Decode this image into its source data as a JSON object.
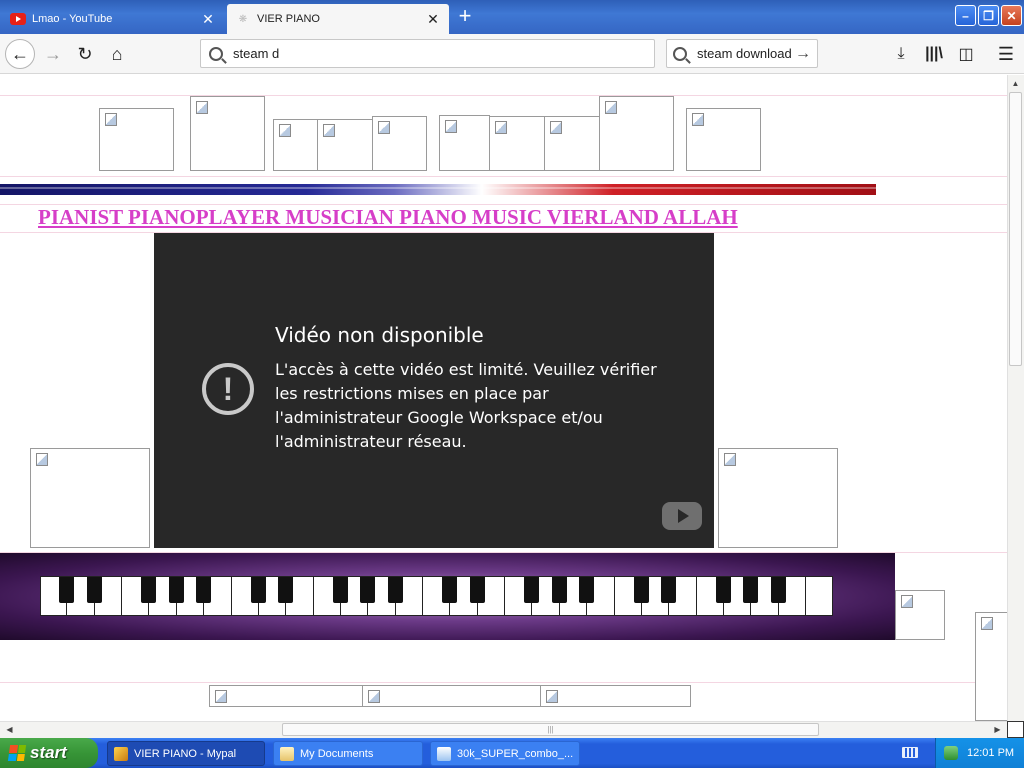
{
  "browser": {
    "tabs": [
      {
        "title": "Lmao - YouTube",
        "active": false,
        "favicon": "youtube-icon"
      },
      {
        "title": "VIER PIANO",
        "active": true,
        "favicon": "page-icon"
      }
    ],
    "new_tab_label": "+",
    "close_glyph": "✕",
    "window_controls": {
      "minimize": "–",
      "maximize": "❐",
      "close": "✕"
    },
    "nav": {
      "back": "←",
      "forward": "→",
      "reload": "↻",
      "home": "⌂"
    },
    "url_value": "steam d",
    "search_value": "steam download",
    "search_go": "→",
    "toolbar_icons": {
      "download": "⤓",
      "library": "|||\\",
      "sidebar": "◫",
      "menu": "☰"
    }
  },
  "page": {
    "heading": "PIANIST PIANOPLAYER MUSICIAN PIANO MUSIC VIERLAND ALLAH",
    "video": {
      "title": "Vidéo non disponible",
      "message": "L'accès à cette vidéo est limité. Veuillez vérifier les restrictions mises en place par l'administrateur Google Workspace et/ou l'administrateur réseau.",
      "error_glyph": "!"
    },
    "piano_white_keys": 29,
    "piano_black_key_pattern": [
      1,
      1,
      0,
      1,
      1,
      1,
      0
    ]
  },
  "scrollbars": {
    "up": "▲",
    "left": "◀",
    "right": "▶",
    "grip": "|||"
  },
  "taskbar": {
    "start_label": "start",
    "items": [
      {
        "label": "VIER PIANO - Mypal",
        "active": true
      },
      {
        "label": "My Documents",
        "active": false
      },
      {
        "label": "30k_SUPER_combo_...",
        "active": false
      }
    ],
    "clock": "12:01 PM"
  },
  "colors": {
    "heading": "#d63ec8",
    "taskbar": "#245edc",
    "start": "#379537",
    "video_bg": "#282828"
  }
}
